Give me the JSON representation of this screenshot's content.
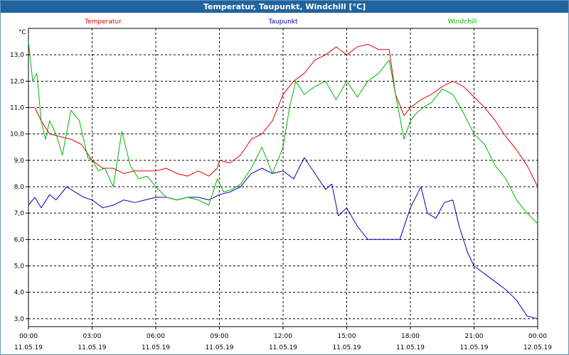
{
  "window": {
    "title": "Temperatur, Taupunkt, Windchill [°C]"
  },
  "chart_data": {
    "type": "line",
    "title": "Temperatur, Taupunkt, Windchill [°C]",
    "ylabel": "°C",
    "xlabel": "",
    "ylim": [
      2.7,
      14.0
    ],
    "xlim": [
      0,
      24
    ],
    "grid": true,
    "legend_position": "top",
    "yticks": [
      3.0,
      4.0,
      5.0,
      6.0,
      7.0,
      8.0,
      9.0,
      10.0,
      11.0,
      12.0,
      13.0
    ],
    "ytick_labels": [
      "3,0",
      "4,0",
      "5,0",
      "6,0",
      "7,0",
      "8,0",
      "9,0",
      "10,0",
      "11,0",
      "12,0",
      "13,0"
    ],
    "xticks": [
      {
        "x": 0,
        "time": "00:00",
        "date": "11.05.19"
      },
      {
        "x": 3,
        "time": "03:00",
        "date": "11.05.19"
      },
      {
        "x": 6,
        "time": "06:00",
        "date": "11.05.19"
      },
      {
        "x": 9,
        "time": "09:00",
        "date": "11.05.19"
      },
      {
        "x": 12,
        "time": "12:00",
        "date": "11.05.19"
      },
      {
        "x": 15,
        "time": "15:00",
        "date": "11.05.19"
      },
      {
        "x": 18,
        "time": "18:00",
        "date": "11.05.19"
      },
      {
        "x": 21,
        "time": "21:00",
        "date": "11.05.19"
      },
      {
        "x": 24,
        "time": "00:00",
        "date": "12.05.19"
      }
    ],
    "series": [
      {
        "name": "Temperatur",
        "color": "#e00000",
        "points": [
          [
            0,
            11.0
          ],
          [
            0.3,
            11.0
          ],
          [
            0.6,
            10.5
          ],
          [
            1,
            10.0
          ],
          [
            1.5,
            9.9
          ],
          [
            2,
            9.8
          ],
          [
            2.5,
            9.6
          ],
          [
            3,
            9.0
          ],
          [
            3.5,
            8.7
          ],
          [
            4,
            8.7
          ],
          [
            4.5,
            8.5
          ],
          [
            5,
            8.6
          ],
          [
            5.5,
            8.6
          ],
          [
            6,
            8.6
          ],
          [
            6.5,
            8.7
          ],
          [
            7,
            8.5
          ],
          [
            7.5,
            8.4
          ],
          [
            8,
            8.6
          ],
          [
            8.5,
            8.4
          ],
          [
            8.9,
            8.7
          ],
          [
            9,
            9.0
          ],
          [
            9.5,
            8.9
          ],
          [
            10,
            9.2
          ],
          [
            10.5,
            9.8
          ],
          [
            11,
            10.0
          ],
          [
            11.5,
            10.5
          ],
          [
            12,
            11.5
          ],
          [
            12.5,
            12.0
          ],
          [
            13,
            12.3
          ],
          [
            13.5,
            12.8
          ],
          [
            14,
            13.0
          ],
          [
            14.5,
            13.3
          ],
          [
            15,
            13.0
          ],
          [
            15.5,
            13.3
          ],
          [
            16,
            13.4
          ],
          [
            16.5,
            13.2
          ],
          [
            17,
            13.2
          ],
          [
            17.3,
            11.5
          ],
          [
            17.7,
            10.7
          ],
          [
            18,
            11.0
          ],
          [
            18.5,
            11.3
          ],
          [
            19,
            11.5
          ],
          [
            19.5,
            11.8
          ],
          [
            20,
            12.0
          ],
          [
            20.5,
            11.8
          ],
          [
            21,
            11.4
          ],
          [
            21.5,
            11.0
          ],
          [
            22,
            10.5
          ],
          [
            22.5,
            9.9
          ],
          [
            23,
            9.4
          ],
          [
            23.5,
            8.8
          ],
          [
            24,
            8.0
          ]
        ]
      },
      {
        "name": "Taupunkt",
        "color": "#0000b4",
        "points": [
          [
            0,
            7.3
          ],
          [
            0.3,
            7.6
          ],
          [
            0.6,
            7.2
          ],
          [
            1,
            7.7
          ],
          [
            1.3,
            7.5
          ],
          [
            1.8,
            8.0
          ],
          [
            2.2,
            7.8
          ],
          [
            2.6,
            7.6
          ],
          [
            3,
            7.5
          ],
          [
            3.5,
            7.2
          ],
          [
            4,
            7.3
          ],
          [
            4.5,
            7.5
          ],
          [
            5,
            7.4
          ],
          [
            5.5,
            7.5
          ],
          [
            6,
            7.6
          ],
          [
            6.5,
            7.6
          ],
          [
            7,
            7.5
          ],
          [
            7.5,
            7.6
          ],
          [
            8,
            7.6
          ],
          [
            8.5,
            7.5
          ],
          [
            9,
            7.7
          ],
          [
            9.5,
            7.8
          ],
          [
            10,
            8.0
          ],
          [
            10.5,
            8.5
          ],
          [
            11,
            8.7
          ],
          [
            11.5,
            8.5
          ],
          [
            12,
            8.6
          ],
          [
            12.5,
            8.3
          ],
          [
            13,
            9.1
          ],
          [
            13.5,
            8.5
          ],
          [
            14,
            7.9
          ],
          [
            14.3,
            8.1
          ],
          [
            14.6,
            6.9
          ],
          [
            15,
            7.2
          ],
          [
            15.5,
            6.5
          ],
          [
            16,
            6.0
          ],
          [
            16.5,
            6.0
          ],
          [
            17,
            6.0
          ],
          [
            17.5,
            6.0
          ],
          [
            18,
            7.2
          ],
          [
            18.5,
            8.0
          ],
          [
            18.8,
            7.0
          ],
          [
            19.2,
            6.8
          ],
          [
            19.6,
            7.4
          ],
          [
            20,
            7.5
          ],
          [
            20.3,
            6.5
          ],
          [
            20.7,
            5.5
          ],
          [
            21,
            5.0
          ],
          [
            21.5,
            4.7
          ],
          [
            22,
            4.4
          ],
          [
            22.5,
            4.1
          ],
          [
            23,
            3.7
          ],
          [
            23.5,
            3.1
          ],
          [
            24,
            3.0
          ]
        ]
      },
      {
        "name": "Windchill",
        "color": "#00b400",
        "points": [
          [
            0,
            13.5
          ],
          [
            0.2,
            12.0
          ],
          [
            0.4,
            12.3
          ],
          [
            0.6,
            10.5
          ],
          [
            0.8,
            9.8
          ],
          [
            1,
            10.5
          ],
          [
            1.3,
            10.0
          ],
          [
            1.6,
            9.2
          ],
          [
            2,
            10.9
          ],
          [
            2.4,
            10.5
          ],
          [
            2.8,
            9.1
          ],
          [
            3,
            9.0
          ],
          [
            3.3,
            8.6
          ],
          [
            3.6,
            8.7
          ],
          [
            4,
            8.0
          ],
          [
            4.4,
            10.1
          ],
          [
            4.8,
            8.8
          ],
          [
            5.2,
            8.3
          ],
          [
            5.6,
            8.4
          ],
          [
            6,
            8.0
          ],
          [
            6.5,
            7.6
          ],
          [
            7,
            7.5
          ],
          [
            7.5,
            7.6
          ],
          [
            8,
            7.5
          ],
          [
            8.5,
            7.3
          ],
          [
            8.9,
            8.3
          ],
          [
            9.2,
            7.8
          ],
          [
            9.6,
            7.9
          ],
          [
            10,
            8.1
          ],
          [
            10.5,
            8.7
          ],
          [
            11,
            9.5
          ],
          [
            11.5,
            8.5
          ],
          [
            12,
            9.5
          ],
          [
            12.3,
            11.0
          ],
          [
            12.6,
            12.0
          ],
          [
            13,
            11.5
          ],
          [
            13.5,
            11.8
          ],
          [
            14,
            12.0
          ],
          [
            14.5,
            11.3
          ],
          [
            15,
            12.0
          ],
          [
            15.5,
            11.4
          ],
          [
            16,
            12.0
          ],
          [
            16.5,
            12.3
          ],
          [
            17,
            12.8
          ],
          [
            17.3,
            11.5
          ],
          [
            17.7,
            9.8
          ],
          [
            18,
            10.5
          ],
          [
            18.3,
            10.8
          ],
          [
            18.6,
            11.0
          ],
          [
            19,
            11.2
          ],
          [
            19.5,
            11.7
          ],
          [
            20,
            11.5
          ],
          [
            20.5,
            10.8
          ],
          [
            21,
            10.0
          ],
          [
            21.5,
            9.6
          ],
          [
            22,
            8.8
          ],
          [
            22.5,
            8.3
          ],
          [
            23,
            7.5
          ],
          [
            23.5,
            7.0
          ],
          [
            24,
            6.6
          ]
        ]
      }
    ]
  }
}
